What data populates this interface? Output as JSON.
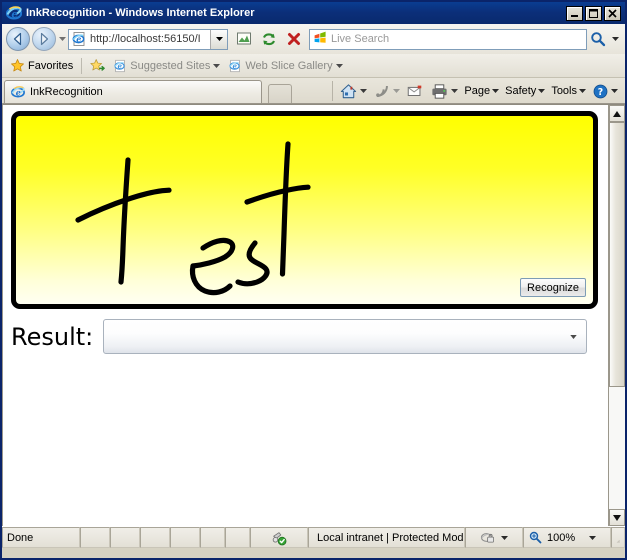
{
  "window": {
    "title": "InkRecognition - Windows Internet Explorer",
    "icon": "ie-logo-icon",
    "minimize_label": "Minimize",
    "maximize_label": "Maximize",
    "close_label": "Close"
  },
  "navbar": {
    "back_label": "Back",
    "forward_label": "Forward",
    "recent_pages_label": "Recent Pages",
    "address": {
      "scheme": "http://",
      "host": "localhost:56150",
      "path": "/I",
      "full": "http://localhost:56150/I",
      "icon": "page-icon",
      "dropdown_label": "Address dropdown"
    },
    "buttons": [
      {
        "name": "compatibility-view-button",
        "label": "Compatibility View"
      },
      {
        "name": "refresh-button",
        "label": "Refresh"
      },
      {
        "name": "stop-button",
        "label": "Stop"
      }
    ],
    "search": {
      "placeholder": "Live Search",
      "value": "",
      "provider_icon": "windows-logo-icon",
      "go_label": "Search",
      "dropdown_label": "Search options"
    }
  },
  "favorites_bar": {
    "favorites_label": "Favorites",
    "add_to_favorites_label": "Add to Favorites Bar",
    "items": [
      {
        "label": "Suggested Sites",
        "icon": "ie-logo-icon",
        "has_caret": true
      },
      {
        "label": "Web Slice Gallery",
        "icon": "ie-logo-icon",
        "has_caret": true
      }
    ]
  },
  "tabs": {
    "items": [
      {
        "label": "InkRecognition",
        "icon": "ie-logo-icon",
        "active": true
      }
    ],
    "new_tab_label": "New Tab"
  },
  "command_bar": {
    "items": [
      {
        "name": "home-button",
        "label": "",
        "icon": "home-icon",
        "has_caret": true
      },
      {
        "name": "feeds-button",
        "label": "",
        "icon": "rss-icon",
        "has_caret": true
      },
      {
        "name": "read-mail-button",
        "label": "",
        "icon": "mail-icon",
        "has_caret": false
      },
      {
        "name": "print-button",
        "label": "",
        "icon": "printer-icon",
        "has_caret": true
      },
      {
        "name": "page-menu",
        "label": "Page",
        "accel": "P",
        "icon": "",
        "has_caret": true
      },
      {
        "name": "safety-menu",
        "label": "Safety",
        "accel": "S",
        "icon": "",
        "has_caret": true
      },
      {
        "name": "tools-menu",
        "label": "Tools",
        "accel": "o",
        "icon": "",
        "has_caret": true
      },
      {
        "name": "help-menu",
        "label": "",
        "icon": "help-icon",
        "has_caret": true
      }
    ]
  },
  "page": {
    "ink_canvas": {
      "name": "ink-input-canvas",
      "handwriting_text": "test",
      "stroke_color": "#000000",
      "background_top_color": "#FFFF00",
      "background_bottom_color": "#FFFFF2"
    },
    "recognize_button": {
      "label": "Recognize"
    },
    "result": {
      "label": "Result:",
      "selected_value": "",
      "placeholder": ""
    }
  },
  "scrollbar": {
    "up_label": "Scroll up",
    "down_label": "Scroll down",
    "thumb_label": "Scroll position"
  },
  "statusbar": {
    "status": "Done",
    "zone": "Local intranet | Protected Mode: On",
    "zone_icon": "globe-icon",
    "security_icon": "protected-mode-icon",
    "zoom_level": "100%",
    "zoom_icon": "magnifier-icon",
    "privacy_icon": "privacy-report-icon"
  },
  "colors": {
    "title_bar": "#0A2A6E",
    "ink_yellow": "#FFFF00",
    "accent_blue": "#1C5FAD",
    "chrome_bg": "#E4E1D6"
  }
}
